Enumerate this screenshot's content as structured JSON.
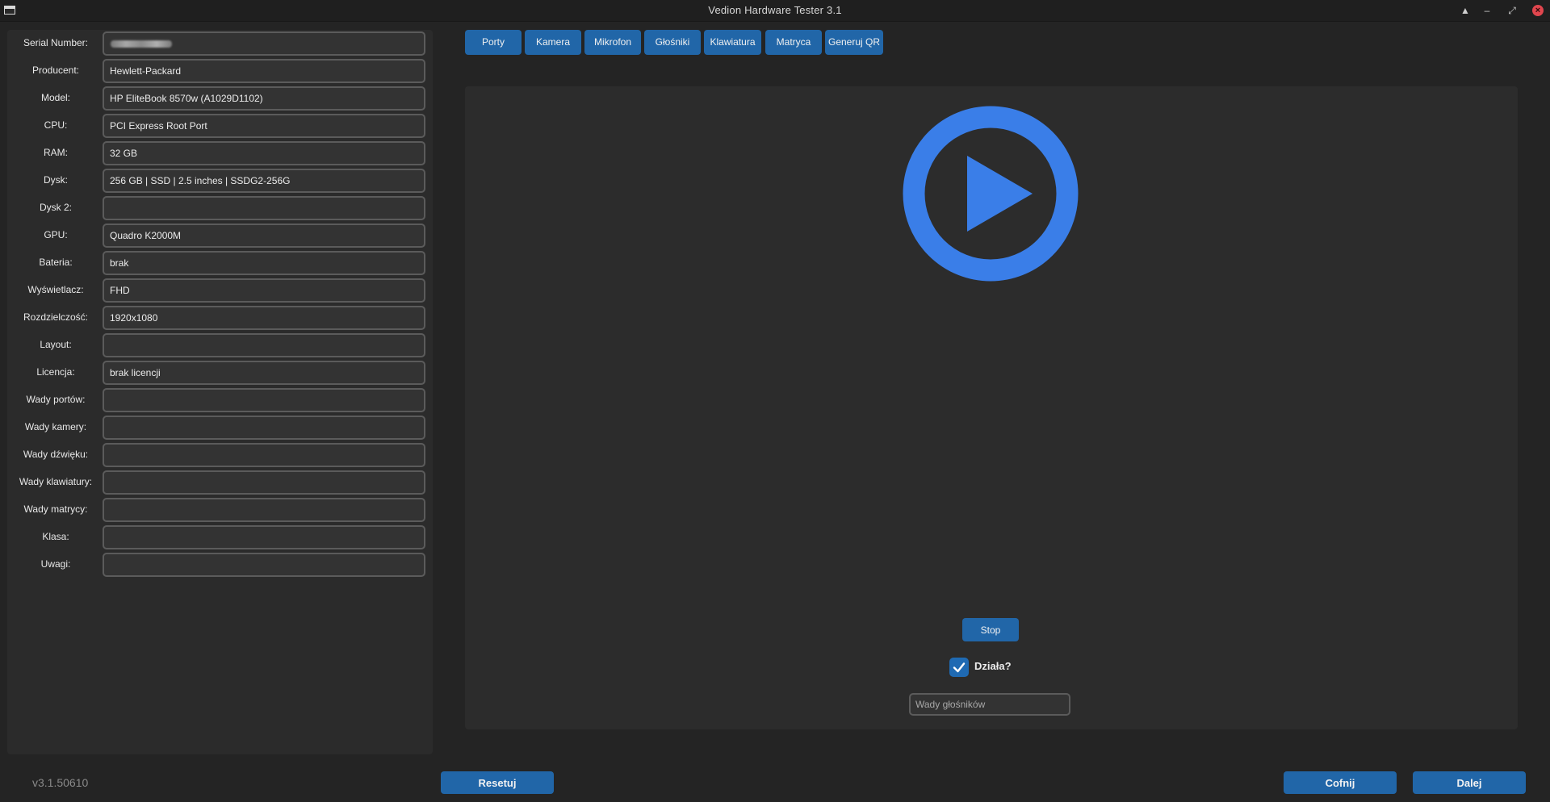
{
  "window": {
    "title": "Vedion Hardware Tester 3.1"
  },
  "fields": [
    {
      "label": "Serial Number:",
      "value": "",
      "redacted": true
    },
    {
      "label": "Producent:",
      "value": "Hewlett-Packard"
    },
    {
      "label": "Model:",
      "value": "HP EliteBook 8570w (A1029D1102)"
    },
    {
      "label": "CPU:",
      "value": "PCI Express Root Port"
    },
    {
      "label": "RAM:",
      "value": "32 GB"
    },
    {
      "label": "Dysk:",
      "value": "256 GB | SSD | 2.5 inches | SSDG2-256G"
    },
    {
      "label": "Dysk 2:",
      "value": ""
    },
    {
      "label": "GPU:",
      "value": "Quadro K2000M"
    },
    {
      "label": "Bateria:",
      "value": "brak"
    },
    {
      "label": "Wyświetlacz:",
      "value": "FHD"
    },
    {
      "label": "Rozdzielczość:",
      "value": "1920x1080"
    },
    {
      "label": "Layout:",
      "value": ""
    },
    {
      "label": "Licencja:",
      "value": "brak licencji"
    },
    {
      "label": "Wady portów:",
      "value": ""
    },
    {
      "label": "Wady kamery:",
      "value": ""
    },
    {
      "label": "Wady dźwięku:",
      "value": ""
    },
    {
      "label": "Wady klawiatury:",
      "value": ""
    },
    {
      "label": "Wady matrycy:",
      "value": ""
    },
    {
      "label": "Klasa:",
      "value": ""
    },
    {
      "label": "Uwagi:",
      "value": ""
    }
  ],
  "tabs": [
    {
      "label": "Porty"
    },
    {
      "label": "Kamera"
    },
    {
      "label": "Mikrofon"
    },
    {
      "label": "Głośniki"
    },
    {
      "label": "Klawiatura"
    },
    {
      "label": "Matryca"
    },
    {
      "label": "Generuj QR"
    }
  ],
  "speaker_test": {
    "stop_label": "Stop",
    "works_label": "Działa?",
    "works_checked": true,
    "defects_placeholder": "Wady głośników",
    "defects_value": "",
    "accent_color": "#3a7ee8"
  },
  "footer": {
    "version": "v3.1.50610",
    "reset_label": "Resetuj",
    "back_label": "Cofnij",
    "next_label": "Dalej"
  },
  "colors": {
    "button": "#2166a8",
    "background": "#242424",
    "panel": "#2b2b2b"
  }
}
